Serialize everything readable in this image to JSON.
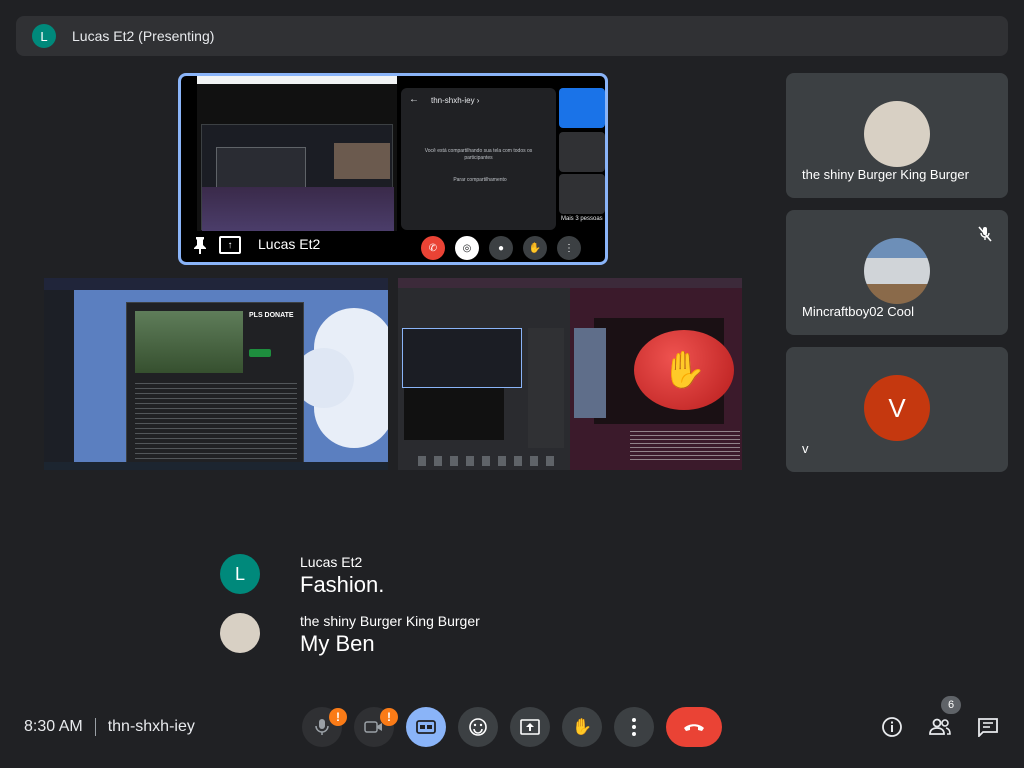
{
  "topbar": {
    "avatar_letter": "L",
    "title": "Lucas Et2 (Presenting)"
  },
  "self_tile": {
    "name": "Lucas Et2",
    "inner_meet_code": "thn-shxh-iey ›",
    "inner_message": "Você está compartilhando sua tela com todos os participantes",
    "inner_stop_button": "Parar compartilhamento",
    "inner_more": "Mais 3 pessoas"
  },
  "shared_screen_1": {
    "title": "PLS DONATE"
  },
  "participants": [
    {
      "name": "the shiny Burger King Burger",
      "avatar_letter": "",
      "muted": false
    },
    {
      "name": "Mincraftboy02 Cool",
      "avatar_letter": "",
      "muted": true
    },
    {
      "name": "v",
      "avatar_letter": "V",
      "muted": false
    }
  ],
  "captions": [
    {
      "avatar_letter": "L",
      "speaker": "Lucas Et2",
      "text": "Fashion.",
      "avatar_color": "#00897b"
    },
    {
      "avatar_letter": "",
      "speaker": "the shiny Burger King Burger",
      "text": "My Ben",
      "avatar_color": "#d8d0c4"
    }
  ],
  "bottombar": {
    "time": "8:30 AM",
    "meeting_code": "thn-shxh-iey",
    "warn_mark": "!",
    "participant_count": "6"
  },
  "colors": {
    "background": "#202124",
    "accent": "#8ab4f8",
    "end_call": "#ea4335",
    "warning": "#fa7b17"
  }
}
